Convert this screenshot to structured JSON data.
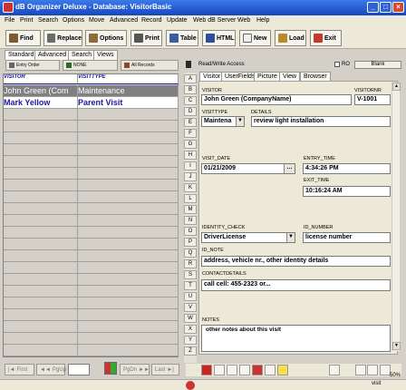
{
  "window": {
    "title": "dB Organizer Deluxe - Database: VisitorBasic"
  },
  "menu": [
    "File",
    "Print",
    "Search",
    "Options",
    "Move",
    "Advanced",
    "Record",
    "Update",
    "Web dB Server",
    "Web",
    "Help"
  ],
  "toolbar": {
    "find": "Find",
    "replace": "Replace",
    "options": "Options",
    "print": "Print",
    "table": "Table",
    "html": "HTML",
    "new": "New",
    "load": "Load",
    "exit": "Exit"
  },
  "left_tabs": [
    "Standard",
    "Advanced",
    "Search",
    "Views"
  ],
  "header_buttons": {
    "entry_order": "Entry Order",
    "none": "NONE",
    "all_records": "All Records"
  },
  "grid": {
    "columns": [
      "VISITOR",
      "VISITTYPE"
    ],
    "rows": [
      [
        "John Green (Com",
        "Maintenance"
      ],
      [
        "Mark Yellow",
        "Parent Visit"
      ]
    ]
  },
  "nav": {
    "first": "First",
    "pgup": "PgUp",
    "pgdn": "PgDn",
    "last": "Last"
  },
  "access": {
    "label": "Read/Write Access",
    "ro": "RO",
    "blank": "Blank"
  },
  "alpha": [
    "A",
    "B",
    "C",
    "D",
    "E",
    "F",
    "G",
    "H",
    "I",
    "J",
    "K",
    "L",
    "M",
    "N",
    "O",
    "P",
    "Q",
    "R",
    "S",
    "T",
    "U",
    "V",
    "W",
    "X",
    "Y",
    "Z"
  ],
  "form_tabs": [
    "Visitor",
    "UserFields",
    "Picture",
    "View",
    "Browser"
  ],
  "form": {
    "visitor_label": "VISITOR",
    "visitor": "John Green (CompanyName)",
    "visitornr_label": "VISITORNR",
    "visitornr": "V-1001",
    "visittype_label": "VISITTYPE",
    "visittype": "Maintena",
    "details_label": "DETAILS",
    "details": "review light installation",
    "visit_date_label": "VISIT_DATE",
    "visit_date": "01/21/2009",
    "entry_time_label": "ENTRY_TIME",
    "entry_time": "4:34:26 PM",
    "exit_time_label": "EXIT_TIME",
    "exit_time": "10:16:24 AM",
    "identity_check_label": "IDENTITY_CHECK",
    "identity_check": "DriverLicense",
    "id_number_label": "ID_NUMBER",
    "id_number": "license number",
    "id_note_label": "ID_NOTE",
    "id_note": "address, vehicle nr., other identity details",
    "contactdetails_label": "CONTACTDETAILS",
    "contactdetails": "call cell: 455-2323 or...",
    "notes_label": "NOTES",
    "notes": "other notes about this visit"
  },
  "status": {
    "zoom": "50%",
    "db": "visit"
  },
  "colors": {
    "title": "#1646c0",
    "header_text": "#1a1a9e",
    "selected_row": "#808080"
  }
}
